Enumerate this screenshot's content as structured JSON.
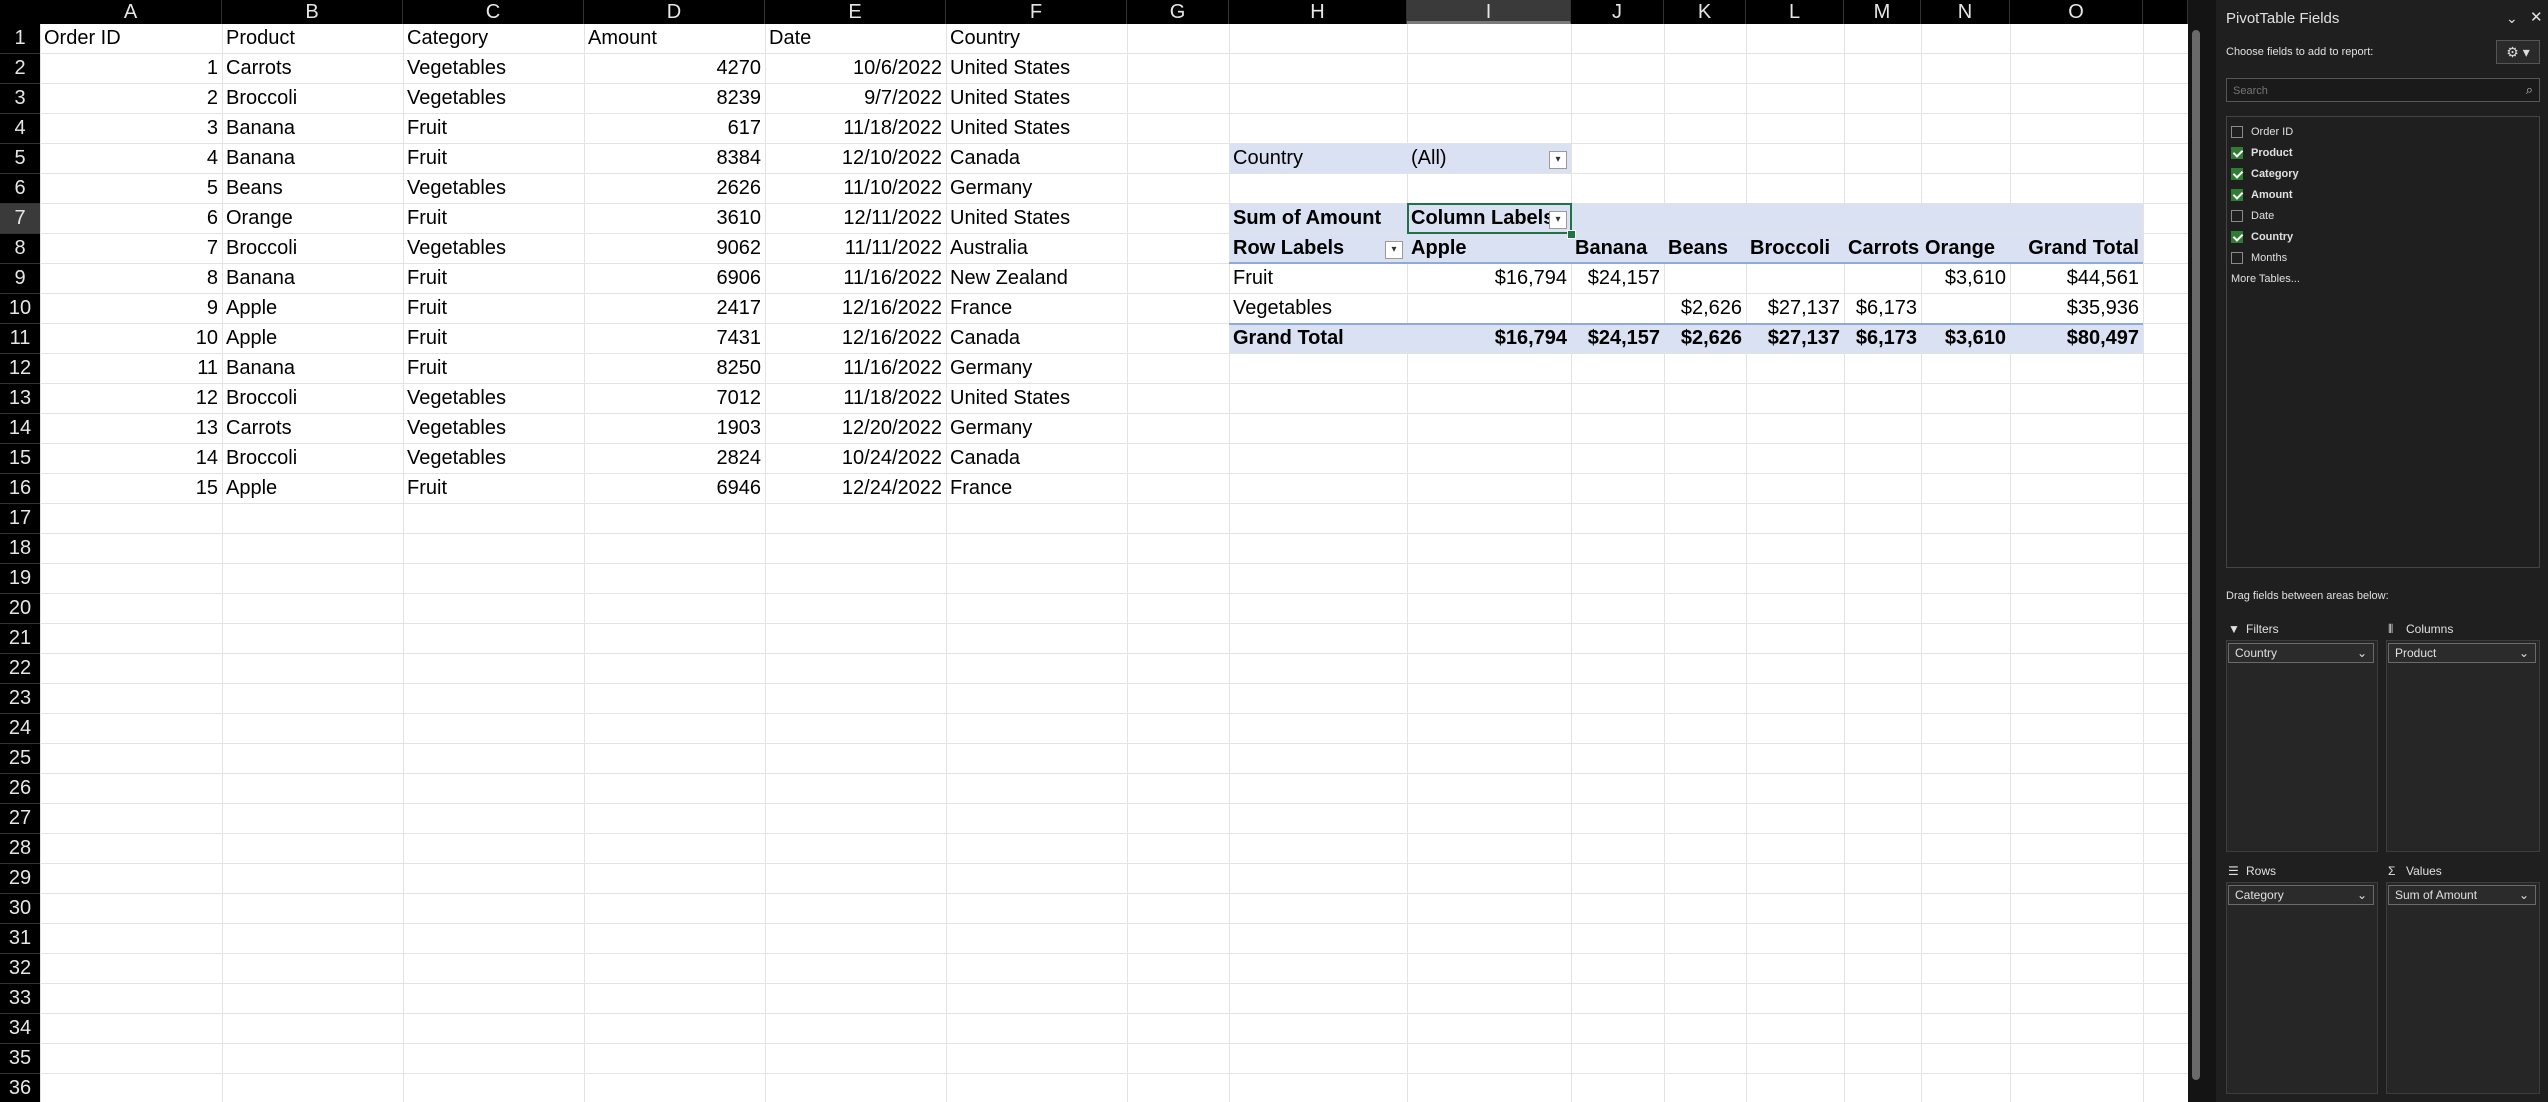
{
  "columns": [
    "A",
    "B",
    "C",
    "D",
    "E",
    "F",
    "G",
    "H",
    "I",
    "J",
    "K",
    "L",
    "M",
    "N",
    "O"
  ],
  "selected_column": "I",
  "rows": [
    "1",
    "2",
    "3",
    "4",
    "5",
    "6",
    "7",
    "8",
    "9",
    "10",
    "11",
    "12",
    "13",
    "14",
    "15",
    "16",
    "17",
    "18",
    "19",
    "20",
    "21",
    "22",
    "23",
    "24",
    "25",
    "26",
    "27",
    "28",
    "29",
    "30",
    "31",
    "32",
    "33",
    "34",
    "35",
    "36"
  ],
  "selected_row": "7",
  "table": {
    "headers": [
      "Order ID",
      "Product",
      "Category",
      "Amount",
      "Date",
      "Country"
    ],
    "records": [
      [
        "1",
        "Carrots",
        "Vegetables",
        "4270",
        "10/6/2022",
        "United States"
      ],
      [
        "2",
        "Broccoli",
        "Vegetables",
        "8239",
        "9/7/2022",
        "United States"
      ],
      [
        "3",
        "Banana",
        "Fruit",
        "617",
        "11/18/2022",
        "United States"
      ],
      [
        "4",
        "Banana",
        "Fruit",
        "8384",
        "12/10/2022",
        "Canada"
      ],
      [
        "5",
        "Beans",
        "Vegetables",
        "2626",
        "11/10/2022",
        "Germany"
      ],
      [
        "6",
        "Orange",
        "Fruit",
        "3610",
        "12/11/2022",
        "United States"
      ],
      [
        "7",
        "Broccoli",
        "Vegetables",
        "9062",
        "11/11/2022",
        "Australia"
      ],
      [
        "8",
        "Banana",
        "Fruit",
        "6906",
        "11/16/2022",
        "New Zealand"
      ],
      [
        "9",
        "Apple",
        "Fruit",
        "2417",
        "12/16/2022",
        "France"
      ],
      [
        "10",
        "Apple",
        "Fruit",
        "7431",
        "12/16/2022",
        "Canada"
      ],
      [
        "11",
        "Banana",
        "Fruit",
        "8250",
        "11/16/2022",
        "Germany"
      ],
      [
        "12",
        "Broccoli",
        "Vegetables",
        "7012",
        "11/18/2022",
        "United States"
      ],
      [
        "13",
        "Carrots",
        "Vegetables",
        "1903",
        "12/20/2022",
        "Germany"
      ],
      [
        "14",
        "Broccoli",
        "Vegetables",
        "2824",
        "10/24/2022",
        "Canada"
      ],
      [
        "15",
        "Apple",
        "Fruit",
        "6946",
        "12/24/2022",
        "France"
      ]
    ]
  },
  "pivot": {
    "filter_label": "Country",
    "filter_value": "(All)",
    "values_label": "Sum of Amount",
    "column_labels": "Column Labels",
    "row_labels": "Row Labels",
    "col_headers": [
      "Apple",
      "Banana",
      "Beans",
      "Broccoli",
      "Carrots",
      "Orange",
      "Grand Total"
    ],
    "rows": [
      {
        "label": "Fruit",
        "values": [
          "$16,794",
          "$24,157",
          "",
          "",
          "",
          "$3,610",
          "$44,561"
        ]
      },
      {
        "label": "Vegetables",
        "values": [
          "",
          "",
          "$2,626",
          "$27,137",
          "$6,173",
          "",
          "$35,936"
        ]
      }
    ],
    "grand_total": {
      "label": "Grand Total",
      "values": [
        "$16,794",
        "$24,157",
        "$2,626",
        "$27,137",
        "$6,173",
        "$3,610",
        "$80,497"
      ]
    }
  },
  "pane": {
    "title": "PivotTable Fields",
    "subtitle": "Choose fields to add to report:",
    "search_placeholder": "Search",
    "fields": [
      {
        "label": "Order ID",
        "checked": false
      },
      {
        "label": "Product",
        "checked": true
      },
      {
        "label": "Category",
        "checked": true
      },
      {
        "label": "Amount",
        "checked": true
      },
      {
        "label": "Date",
        "checked": false
      },
      {
        "label": "Country",
        "checked": true
      },
      {
        "label": "Months",
        "checked": false
      }
    ],
    "more_tables": "More Tables...",
    "drag_hint": "Drag fields between areas below:",
    "areas": {
      "filters": {
        "title": "Filters",
        "item": "Country"
      },
      "columns": {
        "title": "Columns",
        "item": "Product"
      },
      "rows": {
        "title": "Rows",
        "item": "Category"
      },
      "values": {
        "title": "Values",
        "item": "Sum of Amount"
      }
    }
  }
}
